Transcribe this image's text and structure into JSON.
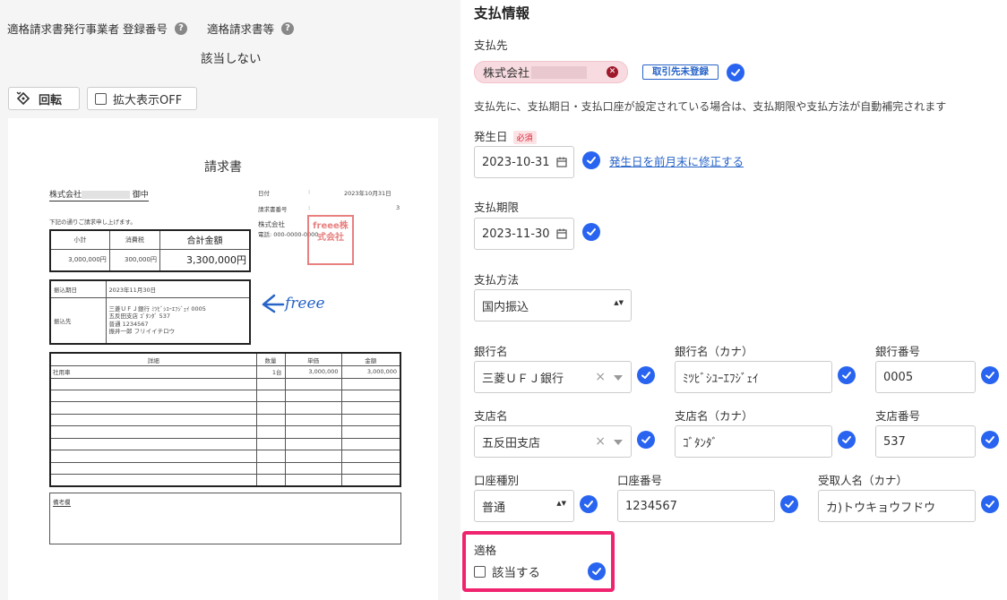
{
  "left": {
    "label_registration_number": "適格請求書発行事業者 登録番号",
    "label_qualified_invoice": "適格請求書等",
    "qualified_value": "該当しない",
    "rotate_label": "回転",
    "zoom_label": "拡大表示OFF",
    "icon_help": "question-circle-icon",
    "icon_rotate": "rotate-icon"
  },
  "invoice": {
    "title": "請求書",
    "client_prefix": "株式会社",
    "client_suffix": "御中",
    "intro": "下記の通りご請求申し上げます。",
    "meta": {
      "date_label": "日付",
      "date_colon": ":",
      "date_value": "2023年10月31日",
      "number_label": "請求書番号",
      "number_colon": ":",
      "number_value": "3",
      "issuer_name": "株式会社",
      "issuer_phone": "電話: 000-0000-0000"
    },
    "summary": {
      "headers": [
        "小計",
        "消費税",
        "合計金額"
      ],
      "values": [
        "3,000,000円",
        "300,000円",
        "3,300,000円"
      ]
    },
    "payment": {
      "due_label": "振込期日",
      "due_value": "2023年11月30日",
      "dest_label": "振込先",
      "dest_lines": [
        "三菱ＵＦＪ銀行 ﾐﾂﾋﾞｼﾕｰｴﾌｼﾞｪｲ 0005",
        "五反田支店 ｺﾞﾀﾝﾀﾞ 537",
        "普通 1234567",
        "振井一郎 フリイイチロウ"
      ]
    },
    "logo_text": "freee",
    "stamp_text": "freee株式会社",
    "details": {
      "headers": [
        "詳細",
        "数量",
        "単価",
        "金額"
      ],
      "rows": [
        [
          "社用車",
          "1台",
          "3,000,000",
          "3,000,000"
        ],
        [
          "",
          "",
          "",
          ""
        ],
        [
          "",
          "",
          "",
          ""
        ],
        [
          "",
          "",
          "",
          ""
        ],
        [
          "",
          "",
          "",
          ""
        ],
        [
          "",
          "",
          "",
          ""
        ],
        [
          "",
          "",
          "",
          ""
        ],
        [
          "",
          "",
          "",
          ""
        ],
        [
          "",
          "",
          "",
          ""
        ],
        [
          "",
          "",
          "",
          ""
        ]
      ]
    },
    "remarks_label": "備考欄"
  },
  "right": {
    "section_title": "支払情報",
    "partner_label": "支払先",
    "partner_name": "株式会社",
    "unregistered_button": "取引先未登録",
    "note": "支払先に、支払期日・支払口座が設定されている場合は、支払期限や支払方法が自動補完されます",
    "issue_date_label": "発生日",
    "required_badge": "必須",
    "issue_date_value": "2023-10-31",
    "fix_link": "発生日を前月末に修正する",
    "due_date_label": "支払期限",
    "due_date_value": "2023-11-30",
    "method_label": "支払方法",
    "method_value": "国内振込",
    "bank_name_label": "銀行名",
    "bank_name_value": "三菱ＵＦＪ銀行",
    "bank_kana_label": "銀行名（カナ）",
    "bank_kana_value": "ﾐﾂﾋﾞｼﾕｰｴﾌｼﾞｪｲ",
    "bank_code_label": "銀行番号",
    "bank_code_value": "0005",
    "branch_label": "支店名",
    "branch_value": "五反田支店",
    "branch_kana_label": "支店名（カナ）",
    "branch_kana_value": "ｺﾞﾀﾝﾀﾞ",
    "branch_code_label": "支店番号",
    "branch_code_value": "537",
    "account_type_label": "口座種別",
    "account_type_value": "普通",
    "account_number_label": "口座番号",
    "account_number_value": "1234567",
    "recipient_label": "受取人名（カナ）",
    "recipient_value": "カ)トウキョウフドウ",
    "qualified_label": "適格",
    "qualified_checkbox_label": "該当する",
    "icon_check": "check-circle-icon",
    "icon_calendar": "calendar-icon",
    "icon_clear": "close-icon",
    "clear_glyph": "×",
    "icon_updown": "select-arrows-icon",
    "updown_glyph": "▲▼",
    "accent_color": "#2864f0",
    "highlight_color": "#f0246e"
  }
}
